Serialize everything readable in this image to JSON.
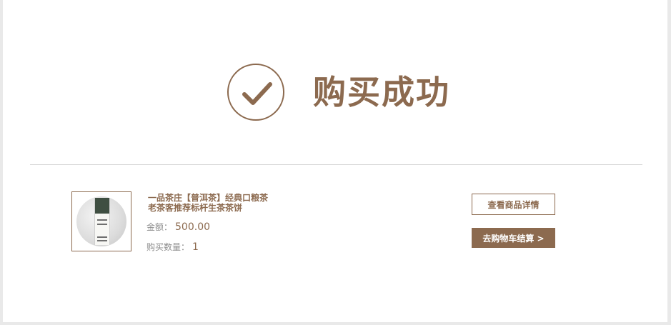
{
  "success": {
    "title": "购买成功",
    "icon": "check-circle-icon"
  },
  "product": {
    "name": "一品茶庄【普洱茶】经典口粮茶老茶客推荐标杆生茶茶饼",
    "image": "tea-cake-image",
    "amount_label": "金额：",
    "amount_value": "500.00",
    "quantity_label": "购买数量：",
    "quantity_value": "1"
  },
  "actions": {
    "view_details_label": "查看商品详情",
    "go_to_cart_label": "去购物车结算 >"
  },
  "colors": {
    "accent": "#8c6a4f",
    "muted_text": "#8e8e8e",
    "divider": "#d6d6d6",
    "page_bg": "#e9e9e9"
  }
}
